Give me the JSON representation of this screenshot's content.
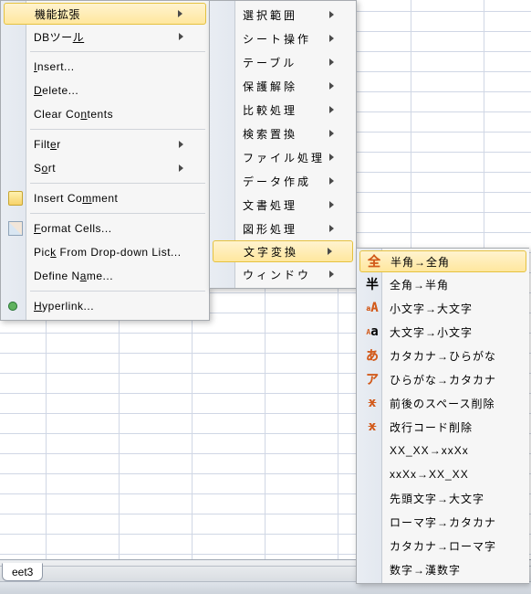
{
  "sheet_tab": "eet3",
  "menu1": {
    "items": [
      {
        "label": "機能拡張",
        "arrow": true,
        "highlight": true
      },
      {
        "label": "DBツール",
        "arrow": true,
        "underline_idx": 3
      }
    ],
    "items2": [
      {
        "label": "Insert...",
        "underline": "I"
      },
      {
        "label": "Delete...",
        "underline": "D"
      },
      {
        "label": "Clear Contents",
        "underline": "n"
      }
    ],
    "items3": [
      {
        "label": "Filter",
        "arrow": true,
        "underline": "e"
      },
      {
        "label": "Sort",
        "arrow": true,
        "underline": "o"
      }
    ],
    "items4": [
      {
        "label": "Insert Comment",
        "icon": "comment",
        "underline": "m"
      },
      {
        "label": "Format Cells...",
        "icon": "format",
        "underline": "F"
      },
      {
        "label": "Pick From Drop-down List...",
        "underline": "K"
      },
      {
        "label": "Define Name...",
        "underline": "a"
      },
      {
        "label": "Hyperlink...",
        "icon": "link",
        "underline": "H"
      }
    ]
  },
  "menu2": {
    "items": [
      {
        "label": "選択範囲",
        "arrow": true
      },
      {
        "label": "シート操作",
        "arrow": true
      },
      {
        "label": "テーブル",
        "arrow": true
      },
      {
        "label": "保護解除",
        "arrow": true
      },
      {
        "label": "比較処理",
        "arrow": true
      },
      {
        "label": "検索置換",
        "arrow": true
      },
      {
        "label": "ファイル処理",
        "arrow": true
      },
      {
        "label": "データ作成",
        "arrow": true
      },
      {
        "label": "文書処理",
        "arrow": true
      },
      {
        "label": "図形処理",
        "arrow": true
      },
      {
        "label": "文字変換",
        "arrow": true,
        "highlight": true
      },
      {
        "label": "ウィンドウ",
        "arrow": true
      }
    ]
  },
  "menu3": {
    "items": [
      {
        "label": "半角→全角",
        "glyph": "全",
        "glyph_orange": true,
        "highlight": true
      },
      {
        "label": "全角→半角",
        "glyph": "半"
      },
      {
        "label": "小文字→大文字",
        "glyph": "A",
        "glyph_orange": true,
        "glyph_sup": "a"
      },
      {
        "label": "大文字→小文字",
        "glyph": "a",
        "glyph_sup": "A"
      },
      {
        "label": "カタカナ→ひらがな",
        "glyph": "あ",
        "glyph_orange": true
      },
      {
        "label": "ひらがな→カタカナ",
        "glyph": "ア",
        "glyph_orange": true
      },
      {
        "label": "前後のスペース削除",
        "glyph": "х",
        "glyph_orange": true,
        "strike": true
      },
      {
        "label": "改行コード削除",
        "glyph": "х",
        "glyph_orange": true,
        "strike": true
      },
      {
        "label": "XX_XX→xxXx"
      },
      {
        "label": "xxXx→XX_XX"
      },
      {
        "label": "先頭文字→大文字"
      },
      {
        "label": "ローマ字→カタカナ"
      },
      {
        "label": "カタカナ→ローマ字"
      },
      {
        "label": "数字→漢数字"
      }
    ]
  }
}
